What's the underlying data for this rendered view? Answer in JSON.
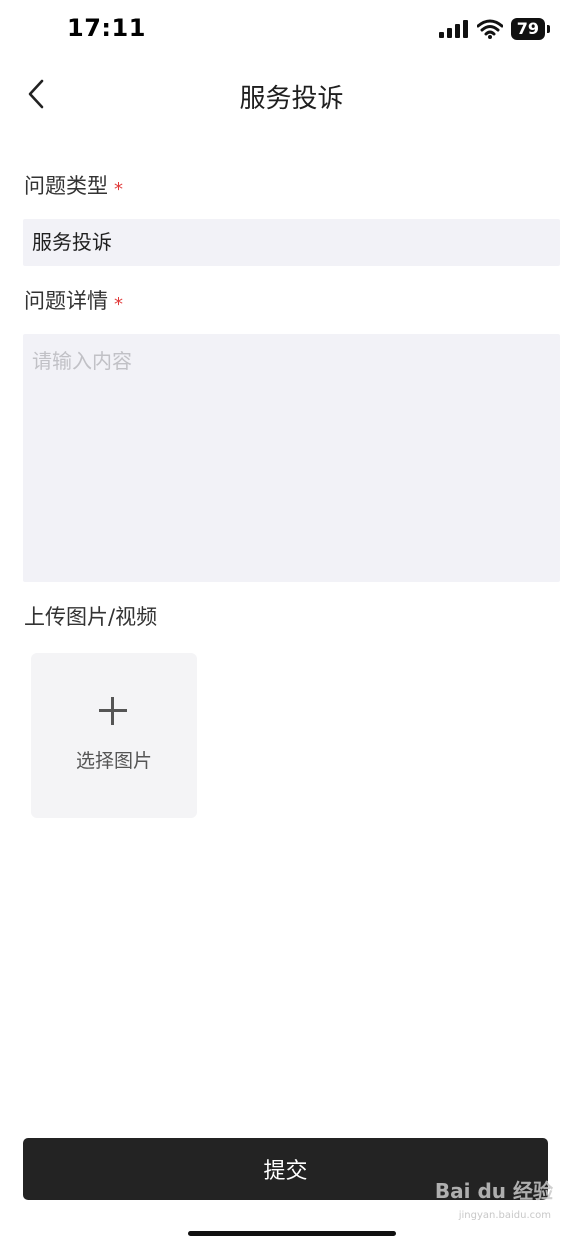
{
  "status_bar": {
    "time": "17:11",
    "battery": "79"
  },
  "header": {
    "title": "服务投诉"
  },
  "form": {
    "type_label": "问题类型",
    "type_value": "服务投诉",
    "detail_label": "问题详情",
    "detail_placeholder": "请输入内容",
    "required_mark": "*",
    "upload_label": "上传图片/视频",
    "upload_button_label": "选择图片"
  },
  "submit_label": "提交",
  "watermark": {
    "brand": "Bai du 经验",
    "url": "jingyan.baidu.com"
  },
  "icons": [
    "back-chevron-icon",
    "signal-icon",
    "wifi-icon",
    "battery-icon",
    "plus-icon",
    "paw-icon"
  ]
}
